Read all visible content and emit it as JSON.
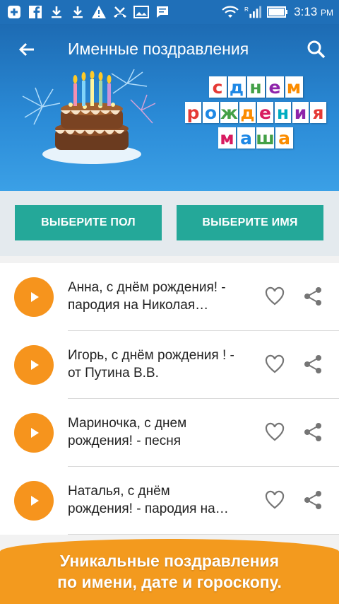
{
  "status_bar": {
    "time": "3:13",
    "ampm": "PM",
    "notification_icons": [
      "plus-box-icon",
      "facebook-icon",
      "download-icon",
      "download-icon",
      "warning-icon",
      "missed-call-icon",
      "image-icon",
      "message-icon"
    ],
    "system_icons": [
      "wifi-icon",
      "signal-icon",
      "battery-icon"
    ]
  },
  "toolbar": {
    "title": "Именные поздравления",
    "back_icon": "arrow-left-icon",
    "search_icon": "search-icon"
  },
  "banner": {
    "lines": [
      [
        "с",
        "д",
        "н",
        "е",
        "м"
      ],
      [
        "р",
        "о",
        "ж",
        "д",
        "е",
        "н",
        "и",
        "я"
      ],
      [
        "м",
        "а",
        "ш",
        "а"
      ]
    ],
    "letter_colors": [
      "#e53935",
      "#43a047",
      "#1e88e5",
      "#fb8c00",
      "#8e24aa",
      "#00acc1",
      "#d81b60",
      "#fdd835"
    ]
  },
  "filters": {
    "gender_label": "ВЫБЕРИТЕ ПОЛ",
    "name_label": "ВЫБЕРИТЕ ИМЯ"
  },
  "list": {
    "items": [
      {
        "line1": "Анна, с днём рождения! -",
        "line2": "пародия на Николая…"
      },
      {
        "line1": "Игорь, с днём рождения ! -",
        "line2": "от Путина В.В."
      },
      {
        "line1": "Мариночка, с днем",
        "line2": "рождения! - песня"
      },
      {
        "line1": "Наталья, с днём",
        "line2": "рождения! - пародия на…"
      }
    ]
  },
  "promo": {
    "line1": "Уникальные поздравления",
    "line2": "по имени, дате и гороскопу."
  },
  "colors": {
    "accent_teal": "#24a899",
    "accent_orange": "#f6941d",
    "header_blue": "#1f6fb8"
  }
}
